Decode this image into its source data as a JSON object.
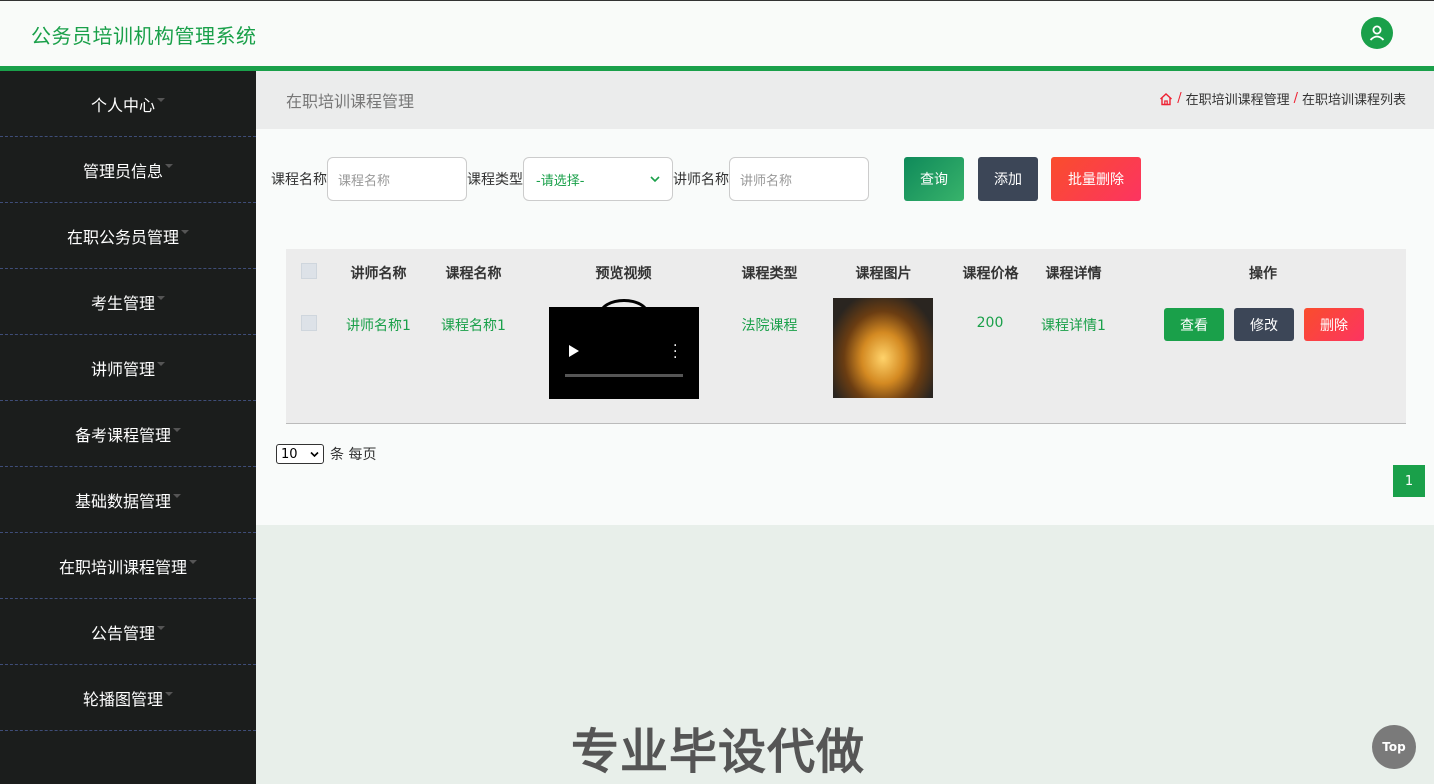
{
  "header": {
    "title": "公务员培训机构管理系统",
    "user_icon": "user-icon"
  },
  "sidebar": {
    "items": [
      {
        "label": "个人中心"
      },
      {
        "label": "管理员信息"
      },
      {
        "label": "在职公务员管理"
      },
      {
        "label": "考生管理"
      },
      {
        "label": "讲师管理"
      },
      {
        "label": "备考课程管理"
      },
      {
        "label": "基础数据管理"
      },
      {
        "label": "在职培训课程管理"
      },
      {
        "label": "公告管理"
      },
      {
        "label": "轮播图管理"
      }
    ]
  },
  "page": {
    "title": "在职培训课程管理",
    "breadcrumb": [
      "在职培训课程管理",
      "在职培训课程列表"
    ]
  },
  "search": {
    "course_name_label": "课程名称",
    "course_name_placeholder": "课程名称",
    "course_type_label": "课程类型",
    "course_type_value": "-请选择-",
    "teacher_name_label": "讲师名称",
    "teacher_name_placeholder": "讲师名称",
    "search_btn": "查询",
    "add_btn": "添加",
    "batch_delete_btn": "批量删除"
  },
  "table": {
    "headers": [
      "讲师名称",
      "课程名称",
      "预览视频",
      "课程类型",
      "课程图片",
      "课程价格",
      "课程详情",
      "操作"
    ],
    "rows": [
      {
        "teacher": "讲师名称1",
        "course": "课程名称1",
        "type": "法院课程",
        "price": "200",
        "detail": "课程详情1",
        "view": "查看",
        "edit": "修改",
        "delete": "删除"
      }
    ]
  },
  "pagination": {
    "page_size": "10",
    "per_page_label": "条 每页",
    "current_page": "1"
  },
  "watermark": "专业毕设代做",
  "top_button": "Top",
  "colors": {
    "accent": "#1aa04a",
    "sidebar_bg": "#1b1d1c",
    "danger": "#fc3461",
    "dark_btn": "#3c4657"
  }
}
